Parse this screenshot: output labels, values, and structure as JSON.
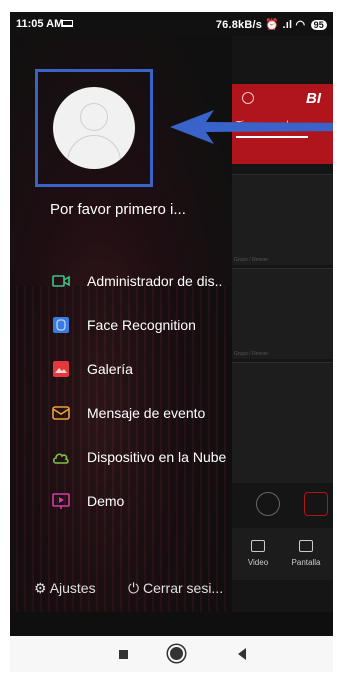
{
  "status_bar": {
    "time": "11:05 AM",
    "right_text": "76.8kB/s",
    "battery": "95"
  },
  "background_app": {
    "brand": "BI",
    "tab_label": "Tiempo real",
    "camera_labels": [
      "Grupo / Renver",
      "Grupo / Renver"
    ],
    "bottom_nav": [
      {
        "label": "Video",
        "icon": "video-icon"
      },
      {
        "label": "Pantalla",
        "icon": "screen-icon"
      }
    ]
  },
  "drawer": {
    "login_prompt": "Por favor primero i...",
    "menu": [
      {
        "label": "Administrador de dis..",
        "icon": "camera-icon",
        "color": "#3cc488"
      },
      {
        "label": "Face Recognition",
        "icon": "face-scan-icon",
        "color": "#3a7be0"
      },
      {
        "label": "Galería",
        "icon": "gallery-icon",
        "color": "#e0393e"
      },
      {
        "label": "Mensaje de evento",
        "icon": "message-icon",
        "color": "#e8a23a"
      },
      {
        "label": "Dispositivo en la Nube",
        "icon": "cloud-icon",
        "color": "#7bc043"
      },
      {
        "label": "Demo",
        "icon": "demo-icon",
        "color": "#d63aa8"
      }
    ],
    "settings_label": "Ajustes",
    "logout_label": "Cerrar sesi..."
  },
  "colors": {
    "highlight_blue": "#3a63c9",
    "app_red": "#b0151c"
  }
}
